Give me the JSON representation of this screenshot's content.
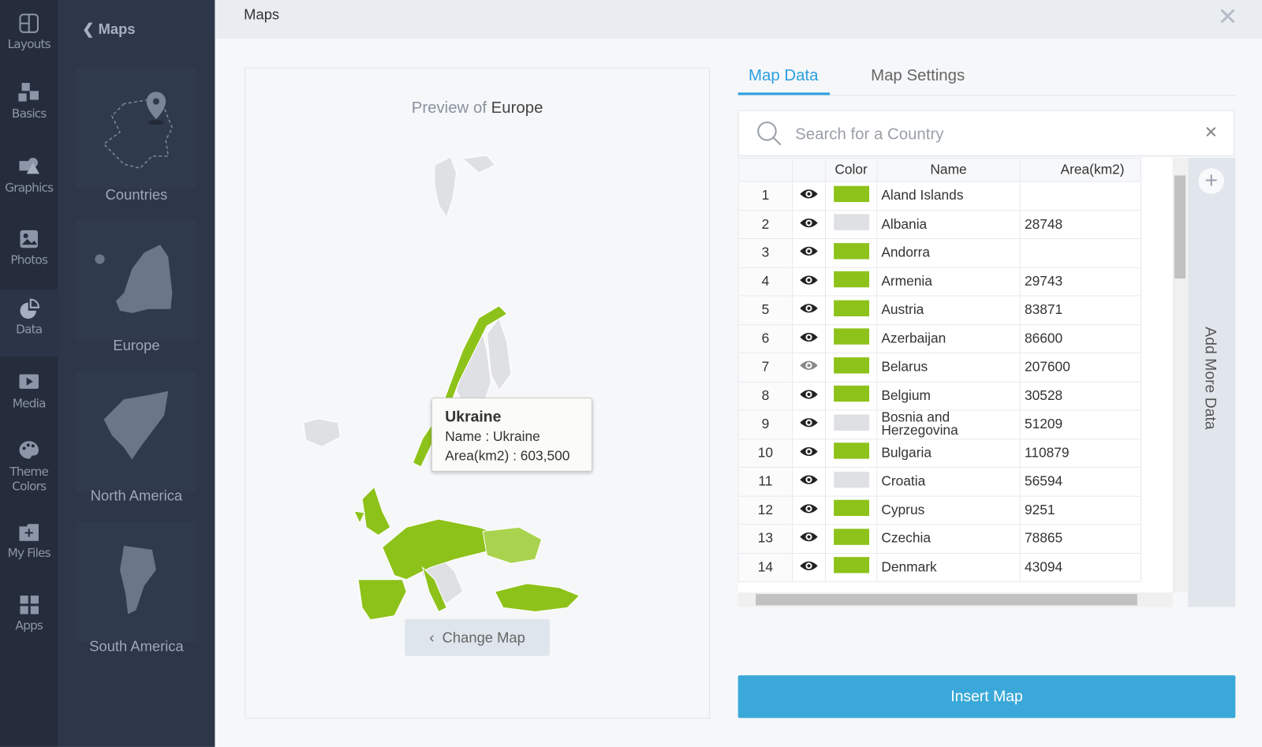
{
  "rail": [
    {
      "label": "Layouts",
      "icon": "layout-icon"
    },
    {
      "label": "Basics",
      "icon": "blocks-icon"
    },
    {
      "label": "Graphics",
      "icon": "shapes-icon"
    },
    {
      "label": "Photos",
      "icon": "image-icon"
    },
    {
      "label": "Data",
      "icon": "pie-chart-icon",
      "active": true
    },
    {
      "label": "Media",
      "icon": "video-icon"
    },
    {
      "label": "Theme Colors",
      "icon": "palette-icon"
    },
    {
      "label": "My Files",
      "icon": "folder-icon"
    },
    {
      "label": "Apps",
      "icon": "apps-icon"
    }
  ],
  "panel": {
    "back_label": "Maps",
    "cards": [
      "Countries",
      "Europe",
      "North America",
      "South America"
    ]
  },
  "header": {
    "title": "Maps"
  },
  "preview": {
    "prefix": "Preview of",
    "map_name": "Europe",
    "change_label": "Change Map"
  },
  "tooltip": {
    "title": "Ukraine",
    "name_line": "Name : Ukraine",
    "area_line": "Area(km2) : 603,500"
  },
  "tabs": [
    "Map Data",
    "Map Settings"
  ],
  "search": {
    "placeholder": "Search for a Country",
    "value": ""
  },
  "table": {
    "headers": [
      "",
      "",
      "Color",
      "Name",
      "Area(km2)"
    ],
    "rows": [
      {
        "n": "1",
        "name": "Aland Islands",
        "area": "",
        "color": "#8dc21a",
        "visible": true
      },
      {
        "n": "2",
        "name": "Albania",
        "area": "28748",
        "color": "#dfe0e4",
        "visible": true
      },
      {
        "n": "3",
        "name": "Andorra",
        "area": "",
        "color": "#8dc21a",
        "visible": true
      },
      {
        "n": "4",
        "name": "Armenia",
        "area": "29743",
        "color": "#8dc21a",
        "visible": true
      },
      {
        "n": "5",
        "name": "Austria",
        "area": "83871",
        "color": "#8dc21a",
        "visible": true
      },
      {
        "n": "6",
        "name": "Azerbaijan",
        "area": "86600",
        "color": "#8dc21a",
        "visible": true
      },
      {
        "n": "7",
        "name": "Belarus",
        "area": "207600",
        "color": "#8dc21a",
        "visible": false
      },
      {
        "n": "8",
        "name": "Belgium",
        "area": "30528",
        "color": "#8dc21a",
        "visible": true
      },
      {
        "n": "9",
        "name": "Bosnia and Herzegovina",
        "area": "51209",
        "color": "#dfe0e4",
        "visible": true
      },
      {
        "n": "10",
        "name": "Bulgaria",
        "area": "110879",
        "color": "#8dc21a",
        "visible": true
      },
      {
        "n": "11",
        "name": "Croatia",
        "area": "56594",
        "color": "#dfe0e4",
        "visible": true
      },
      {
        "n": "12",
        "name": "Cyprus",
        "area": "9251",
        "color": "#8dc21a",
        "visible": true
      },
      {
        "n": "13",
        "name": "Czechia",
        "area": "78865",
        "color": "#8dc21a",
        "visible": true
      },
      {
        "n": "14",
        "name": "Denmark",
        "area": "43094",
        "color": "#8dc21a",
        "visible": true
      }
    ]
  },
  "add_more_label": "Add More Data",
  "insert_label": "Insert Map",
  "colors": {
    "accent": "#2a9fe0",
    "map_green": "#8dc21a",
    "map_grey": "#dfe0e4",
    "insert": "#3aa9d9"
  }
}
